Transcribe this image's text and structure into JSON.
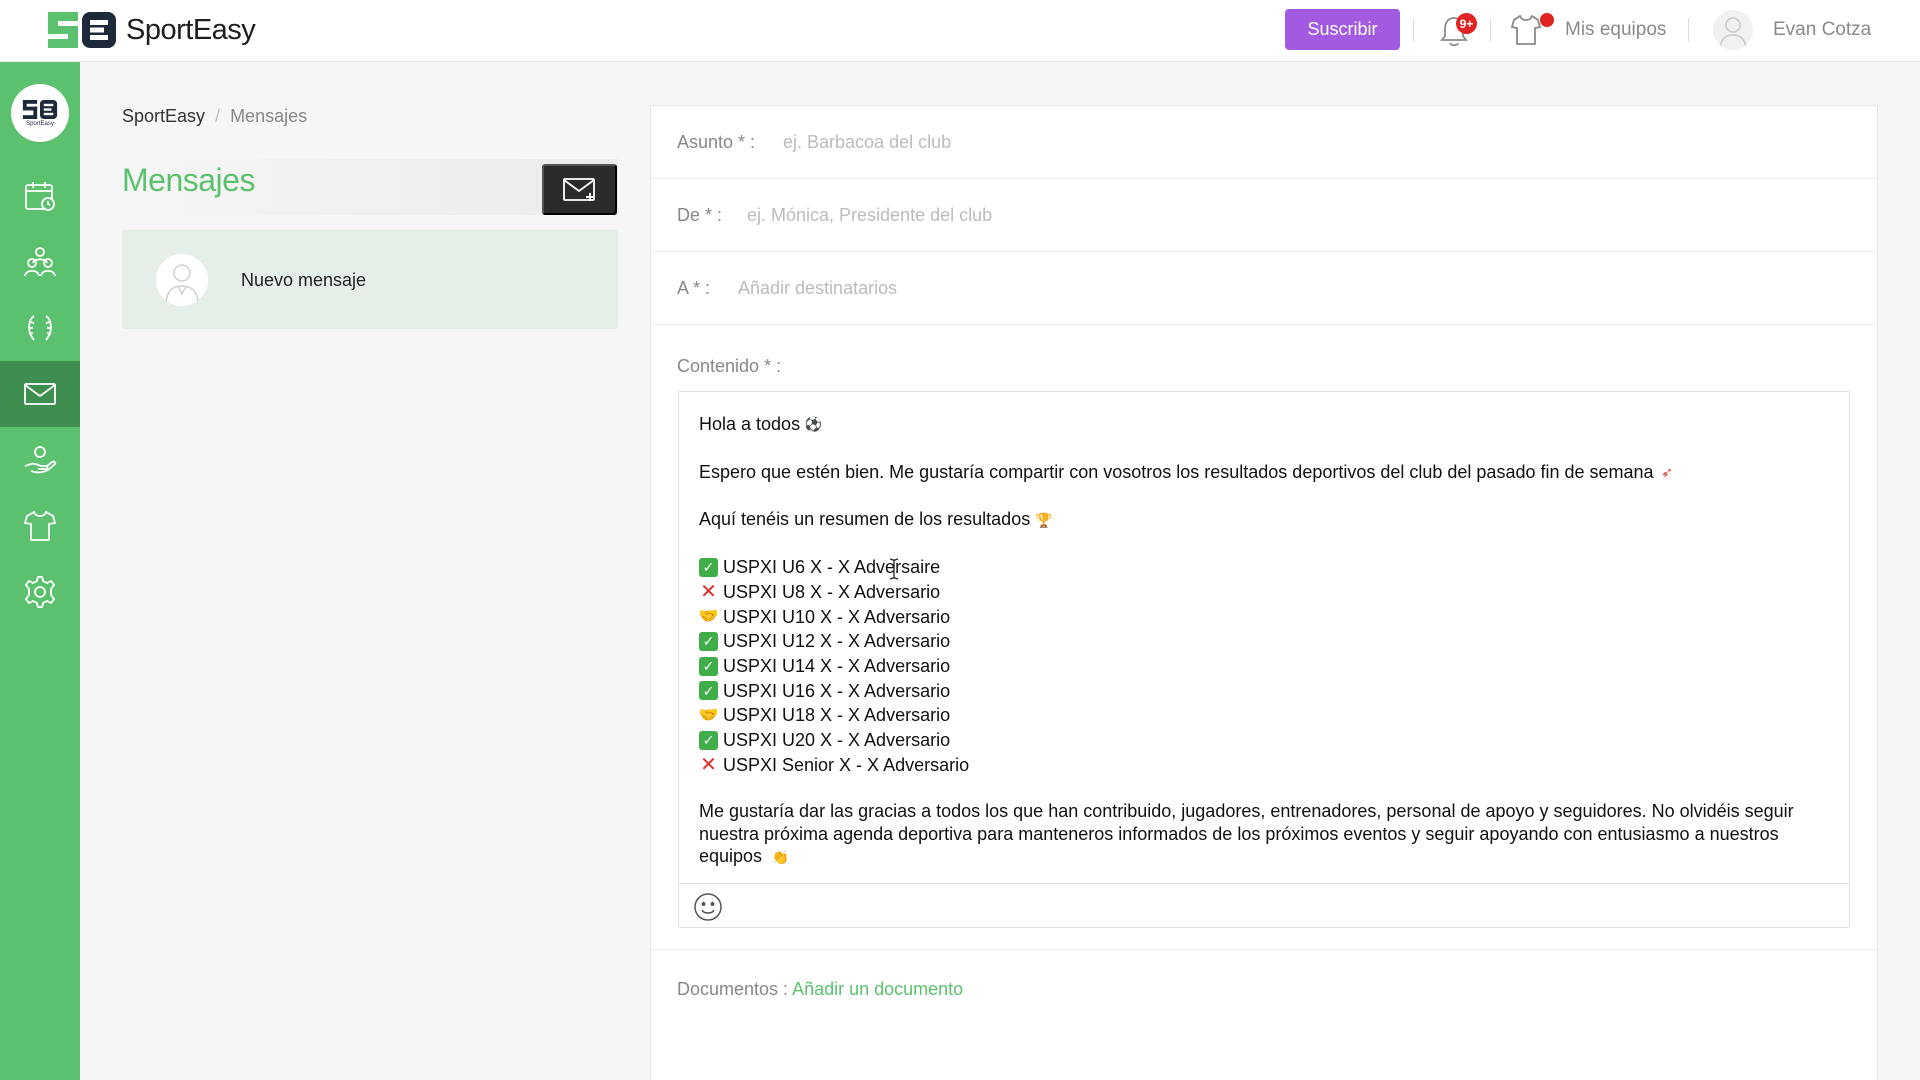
{
  "app": {
    "logo_text": "SportEasy",
    "side_logo_text": "SportEasy"
  },
  "topbar": {
    "subscribe_label": "Suscribir",
    "notification_badge": "9+",
    "my_teams_label": "Mis equipos",
    "user_name": "Evan Cotza"
  },
  "sidebar": {
    "items": [
      {
        "name": "calendar",
        "icon": "calendar-icon"
      },
      {
        "name": "members",
        "icon": "people-icon"
      },
      {
        "name": "competitions",
        "icon": "laurel-icon"
      },
      {
        "name": "messages",
        "icon": "envelope-icon",
        "active": true
      },
      {
        "name": "sponsors",
        "icon": "hand-heart-icon"
      },
      {
        "name": "teams",
        "icon": "shirt-icon"
      },
      {
        "name": "settings",
        "icon": "gear-icon"
      }
    ]
  },
  "breadcrumb": {
    "root": "SportEasy",
    "separator": "/",
    "current": "Mensajes"
  },
  "page": {
    "title": "Mensajes",
    "new_message_label": "Nuevo mensaje"
  },
  "form": {
    "subject_label": "Asunto * :",
    "subject_placeholder": "ej. Barbacoa del club",
    "from_label": "De * :",
    "from_placeholder": "ej. Mónica, Presidente del club",
    "to_label": "A * :",
    "to_placeholder": "Añadir destinatarios",
    "content_label": "Contenido * :",
    "documents_label": "Documentos :",
    "documents_link": "Añadir un documento"
  },
  "message": {
    "greeting": "Hola a todos",
    "intro": "Espero que estén bien. Me gustaría compartir con vosotros los resultados deportivos del club del pasado fin de semana",
    "summary": "Aquí tenéis un resumen de los resultados",
    "results": [
      {
        "status": "win",
        "text": "USPXI U6 X - X Adversaire"
      },
      {
        "status": "loss",
        "text": "USPXI U8 X - X Adversario"
      },
      {
        "status": "draw",
        "text": "USPXI U10 X - X Adversario"
      },
      {
        "status": "win",
        "text": "USPXI U12 X - X Adversario"
      },
      {
        "status": "win",
        "text": "USPXI U14 X - X Adversario"
      },
      {
        "status": "win",
        "text": "USPXI U16 X - X Adversario"
      },
      {
        "status": "draw",
        "text": "USPXI U18 X - X Adversario"
      },
      {
        "status": "win",
        "text": "USPXI U20 X - X Adversario"
      },
      {
        "status": "loss",
        "text": "USPXI Senior X - X Adversario"
      }
    ],
    "closing": "Me gustaría dar las gracias a todos los que han contribuido, jugadores, entrenadores, personal de apoyo y seguidores. No olvidéis seguir nuestra próxima agenda deportiva para manteneros informados de los próximos eventos y seguir apoyando con entusiasmo a nuestros equipos"
  },
  "colors": {
    "brand_green": "#5cc16f",
    "sidebar_active": "#3e8f4f",
    "subscribe_purple": "#a15ae0",
    "alert_red": "#e02424"
  }
}
